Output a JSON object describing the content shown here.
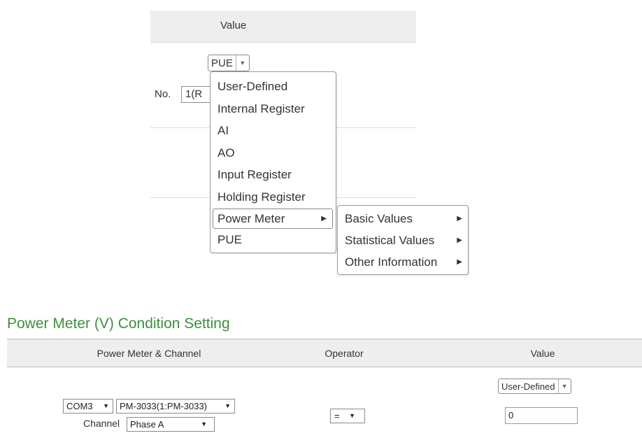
{
  "top_panel": {
    "header": "Value",
    "source_select": "PUE",
    "no_label": "No.",
    "no_value": "1(R",
    "menu": {
      "items": [
        {
          "label": "User-Defined"
        },
        {
          "label": "Internal Register"
        },
        {
          "label": "AI"
        },
        {
          "label": "AO"
        },
        {
          "label": "Input Register"
        },
        {
          "label": "Holding Register"
        },
        {
          "label": "Power Meter",
          "submenu": true
        },
        {
          "label": "PUE"
        }
      ],
      "hovered": "Power Meter"
    },
    "submenu": {
      "items": [
        {
          "label": "Basic Values"
        },
        {
          "label": "Statistical Values"
        },
        {
          "label": "Other Information"
        }
      ]
    }
  },
  "section": {
    "title": "Power Meter (V) Condition Setting",
    "columns": [
      "Power Meter & Channel",
      "Operator",
      "Value"
    ],
    "row": {
      "com_port": "COM3",
      "meter": "PM-3033(1:PM-3033)",
      "channel_label": "Channel",
      "channel": "Phase A",
      "operator": "=",
      "value_type": "User-Defined",
      "value": "0"
    }
  },
  "icons": {
    "dropdown": "triangle-down-icon",
    "submenu": "triangle-right-icon"
  }
}
